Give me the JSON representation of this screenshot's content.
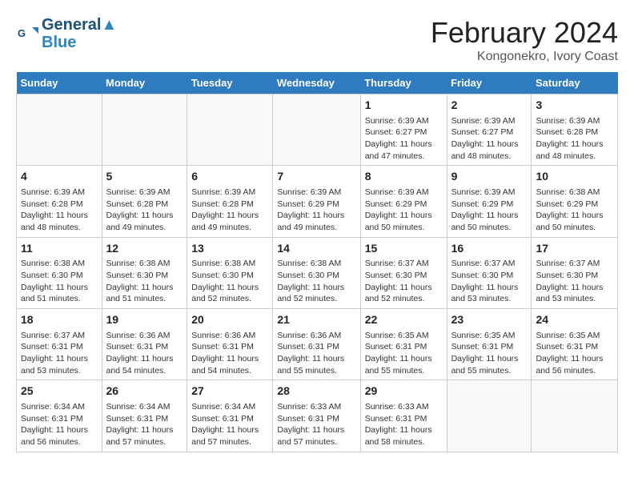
{
  "logo": {
    "line1": "General",
    "line2": "Blue"
  },
  "title": "February 2024",
  "subtitle": "Kongonekro, Ivory Coast",
  "weekdays": [
    "Sunday",
    "Monday",
    "Tuesday",
    "Wednesday",
    "Thursday",
    "Friday",
    "Saturday"
  ],
  "weeks": [
    [
      {
        "day": "",
        "info": ""
      },
      {
        "day": "",
        "info": ""
      },
      {
        "day": "",
        "info": ""
      },
      {
        "day": "",
        "info": ""
      },
      {
        "day": "1",
        "info": "Sunrise: 6:39 AM\nSunset: 6:27 PM\nDaylight: 11 hours\nand 47 minutes."
      },
      {
        "day": "2",
        "info": "Sunrise: 6:39 AM\nSunset: 6:27 PM\nDaylight: 11 hours\nand 48 minutes."
      },
      {
        "day": "3",
        "info": "Sunrise: 6:39 AM\nSunset: 6:28 PM\nDaylight: 11 hours\nand 48 minutes."
      }
    ],
    [
      {
        "day": "4",
        "info": "Sunrise: 6:39 AM\nSunset: 6:28 PM\nDaylight: 11 hours\nand 48 minutes."
      },
      {
        "day": "5",
        "info": "Sunrise: 6:39 AM\nSunset: 6:28 PM\nDaylight: 11 hours\nand 49 minutes."
      },
      {
        "day": "6",
        "info": "Sunrise: 6:39 AM\nSunset: 6:28 PM\nDaylight: 11 hours\nand 49 minutes."
      },
      {
        "day": "7",
        "info": "Sunrise: 6:39 AM\nSunset: 6:29 PM\nDaylight: 11 hours\nand 49 minutes."
      },
      {
        "day": "8",
        "info": "Sunrise: 6:39 AM\nSunset: 6:29 PM\nDaylight: 11 hours\nand 50 minutes."
      },
      {
        "day": "9",
        "info": "Sunrise: 6:39 AM\nSunset: 6:29 PM\nDaylight: 11 hours\nand 50 minutes."
      },
      {
        "day": "10",
        "info": "Sunrise: 6:38 AM\nSunset: 6:29 PM\nDaylight: 11 hours\nand 50 minutes."
      }
    ],
    [
      {
        "day": "11",
        "info": "Sunrise: 6:38 AM\nSunset: 6:30 PM\nDaylight: 11 hours\nand 51 minutes."
      },
      {
        "day": "12",
        "info": "Sunrise: 6:38 AM\nSunset: 6:30 PM\nDaylight: 11 hours\nand 51 minutes."
      },
      {
        "day": "13",
        "info": "Sunrise: 6:38 AM\nSunset: 6:30 PM\nDaylight: 11 hours\nand 52 minutes."
      },
      {
        "day": "14",
        "info": "Sunrise: 6:38 AM\nSunset: 6:30 PM\nDaylight: 11 hours\nand 52 minutes."
      },
      {
        "day": "15",
        "info": "Sunrise: 6:37 AM\nSunset: 6:30 PM\nDaylight: 11 hours\nand 52 minutes."
      },
      {
        "day": "16",
        "info": "Sunrise: 6:37 AM\nSunset: 6:30 PM\nDaylight: 11 hours\nand 53 minutes."
      },
      {
        "day": "17",
        "info": "Sunrise: 6:37 AM\nSunset: 6:30 PM\nDaylight: 11 hours\nand 53 minutes."
      }
    ],
    [
      {
        "day": "18",
        "info": "Sunrise: 6:37 AM\nSunset: 6:31 PM\nDaylight: 11 hours\nand 53 minutes."
      },
      {
        "day": "19",
        "info": "Sunrise: 6:36 AM\nSunset: 6:31 PM\nDaylight: 11 hours\nand 54 minutes."
      },
      {
        "day": "20",
        "info": "Sunrise: 6:36 AM\nSunset: 6:31 PM\nDaylight: 11 hours\nand 54 minutes."
      },
      {
        "day": "21",
        "info": "Sunrise: 6:36 AM\nSunset: 6:31 PM\nDaylight: 11 hours\nand 55 minutes."
      },
      {
        "day": "22",
        "info": "Sunrise: 6:35 AM\nSunset: 6:31 PM\nDaylight: 11 hours\nand 55 minutes."
      },
      {
        "day": "23",
        "info": "Sunrise: 6:35 AM\nSunset: 6:31 PM\nDaylight: 11 hours\nand 55 minutes."
      },
      {
        "day": "24",
        "info": "Sunrise: 6:35 AM\nSunset: 6:31 PM\nDaylight: 11 hours\nand 56 minutes."
      }
    ],
    [
      {
        "day": "25",
        "info": "Sunrise: 6:34 AM\nSunset: 6:31 PM\nDaylight: 11 hours\nand 56 minutes."
      },
      {
        "day": "26",
        "info": "Sunrise: 6:34 AM\nSunset: 6:31 PM\nDaylight: 11 hours\nand 57 minutes."
      },
      {
        "day": "27",
        "info": "Sunrise: 6:34 AM\nSunset: 6:31 PM\nDaylight: 11 hours\nand 57 minutes."
      },
      {
        "day": "28",
        "info": "Sunrise: 6:33 AM\nSunset: 6:31 PM\nDaylight: 11 hours\nand 57 minutes."
      },
      {
        "day": "29",
        "info": "Sunrise: 6:33 AM\nSunset: 6:31 PM\nDaylight: 11 hours\nand 58 minutes."
      },
      {
        "day": "",
        "info": ""
      },
      {
        "day": "",
        "info": ""
      }
    ]
  ]
}
